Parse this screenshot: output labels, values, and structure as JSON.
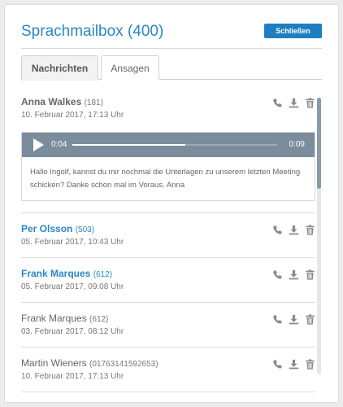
{
  "header": {
    "title": "Sprachmailbox (400)",
    "close_label": "Schließen"
  },
  "tabs": [
    {
      "label": "Nachrichten"
    },
    {
      "label": "Ansagen"
    }
  ],
  "messages": [
    {
      "name": "Anna Walkes",
      "ext": "(181)",
      "date": "10. Februar 2017, 17:13 Uhr"
    },
    {
      "name": "Per Olsson",
      "ext": "(503)",
      "date": "05. Februar 2017, 10:43 Uhr"
    },
    {
      "name": "Frank Marques",
      "ext": "(612)",
      "date": "05. Februar 2017, 09:08 Uhr"
    },
    {
      "name": "Frank Marques",
      "ext": "(612)",
      "date": "03. Februar 2017, 08:12 Uhr"
    },
    {
      "name": "Martin Wieners",
      "ext": "(01763141592653)",
      "date": "10. Februar 2017, 17:13 Uhr"
    }
  ],
  "player": {
    "current_time": "0:04",
    "total_time": "0:09",
    "progress": 0.55
  },
  "expanded_text": "Hallo Ingolf, kannst du mir nochmal die Unterlagen zu unserem letzten Meeting schicken? Danke schon mal im Voraus. Anna",
  "icons": {
    "call": "phone-icon",
    "download": "download-icon",
    "delete": "trash-icon"
  },
  "colors": {
    "accent": "#2b87c3",
    "button": "#1f7ec0",
    "player": "#7b8d9c"
  }
}
